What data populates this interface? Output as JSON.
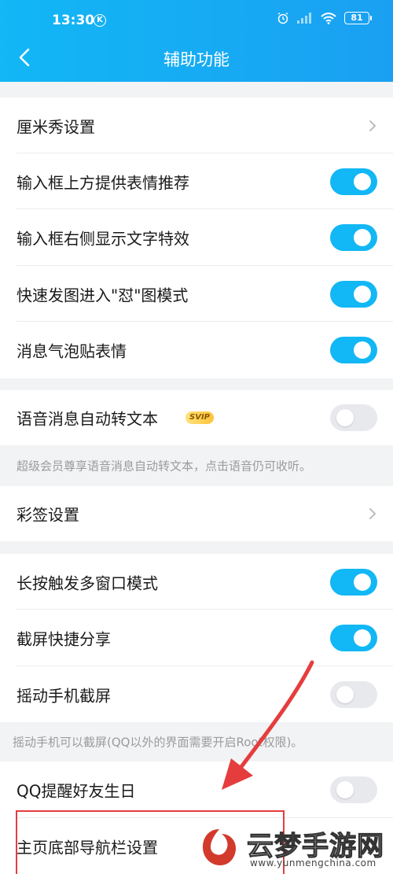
{
  "status_bar": {
    "time": "13:30",
    "k_badge": "K",
    "battery": "81"
  },
  "header": {
    "title": "辅助功能",
    "back_icon": "chevron-left-icon",
    "bg_color": "#12b7f5"
  },
  "settings": {
    "cmshow": {
      "label": "厘米秀设置"
    },
    "emoji_suggest": {
      "label": "输入框上方提供表情推荐",
      "enabled": true
    },
    "text_effect": {
      "label": "输入框右侧显示文字特效",
      "enabled": true
    },
    "quick_image": {
      "label": "快速发图进入\"怼\"图模式",
      "enabled": true
    },
    "bubble_sticker": {
      "label": "消息气泡贴表情",
      "enabled": true
    },
    "voice_to_text": {
      "label": "语音消息自动转文本",
      "badge": "SVIP",
      "enabled": false
    },
    "voice_note": "超级会员尊享语音消息自动转文本，点击语音仍可收听。",
    "caiqian": {
      "label": "彩签设置"
    },
    "multiwindow": {
      "label": "长按触发多窗口模式",
      "enabled": true
    },
    "screenshot_share": {
      "label": "截屏快捷分享",
      "enabled": true
    },
    "shake_screenshot": {
      "label": "摇动手机截屏",
      "enabled": false
    },
    "shake_note": "摇动手机可以截屏(QQ以外的界面需要开启Root权限)。",
    "birthday": {
      "label": "QQ提醒好友生日",
      "enabled": false
    },
    "navbar": {
      "label": "主页底部导航栏设置"
    }
  },
  "watermark": {
    "text": "云梦手游网",
    "url": "www.yunmengchina.com"
  },
  "colors": {
    "accent": "#12b7f5",
    "annotation": "#e53d3d"
  }
}
